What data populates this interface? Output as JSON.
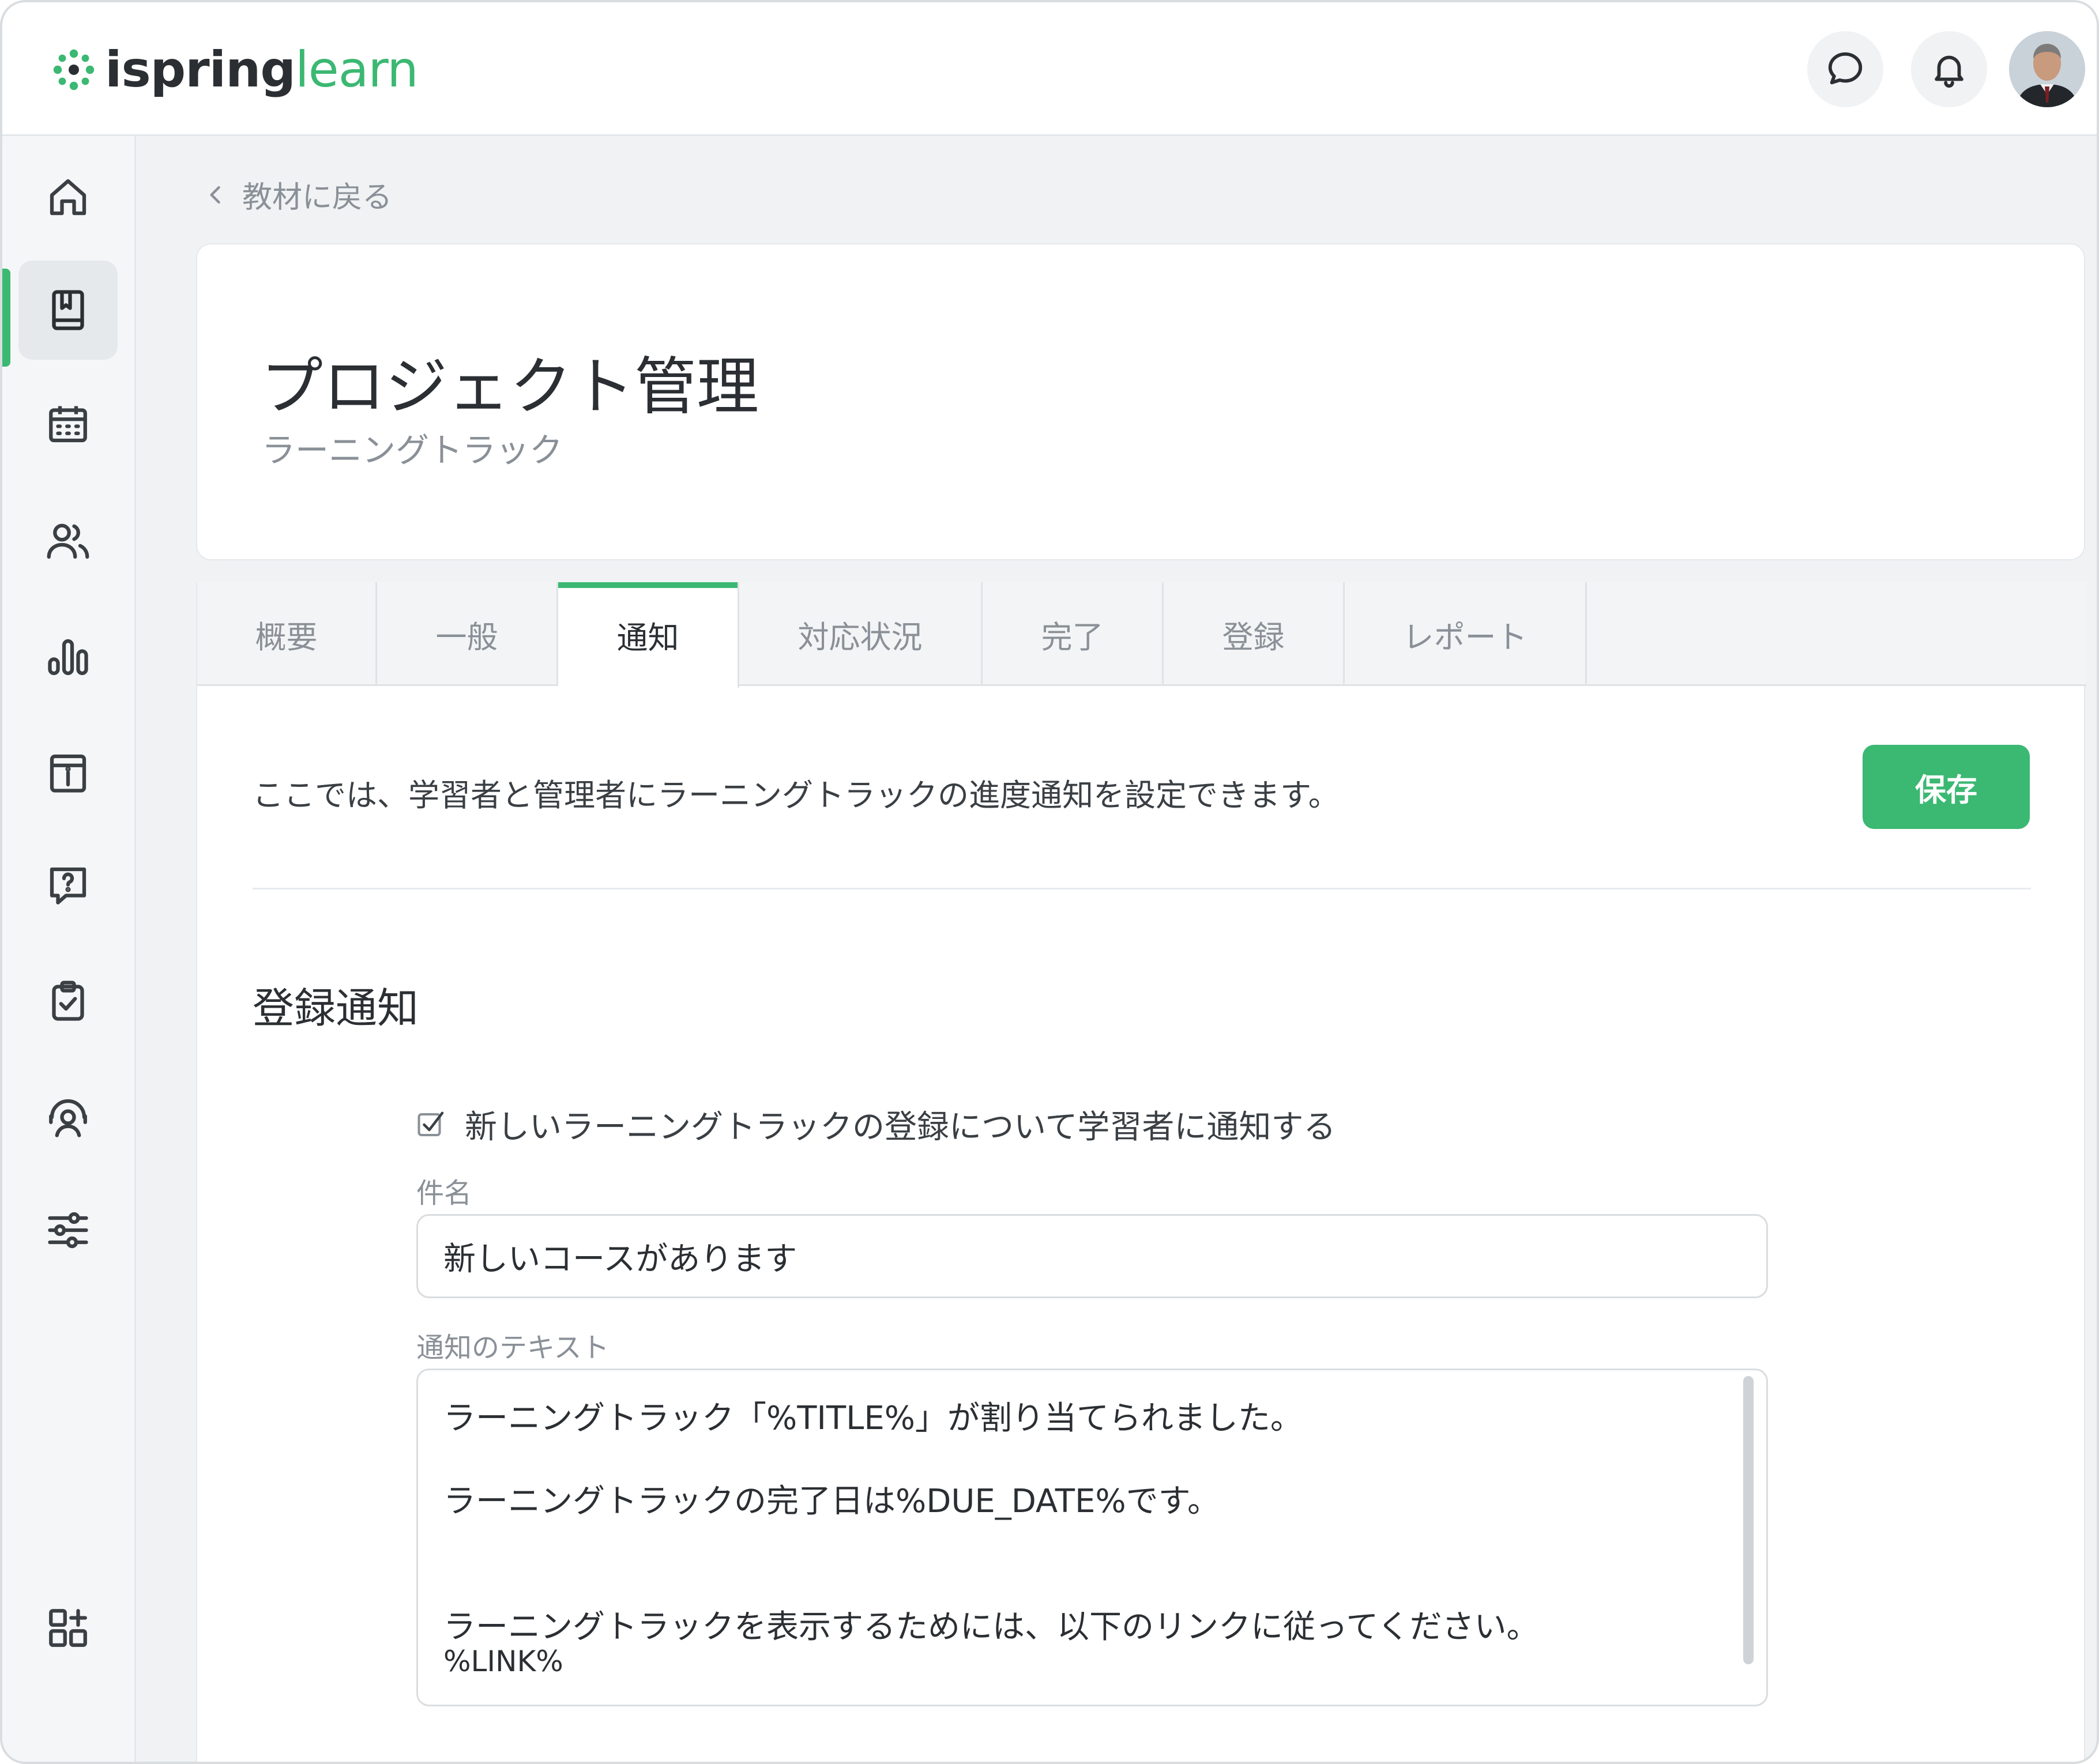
{
  "app": {
    "logo_part1": "ispring",
    "logo_part2": "learn",
    "brand_color": "#3bb872"
  },
  "header": {
    "icons": [
      "chat-icon",
      "bell-icon",
      "avatar"
    ]
  },
  "sidebar": {
    "items": [
      {
        "icon": "home-icon",
        "active": false
      },
      {
        "icon": "book-icon",
        "active": true
      },
      {
        "icon": "calendar-icon",
        "active": false
      },
      {
        "icon": "users-icon",
        "active": false
      },
      {
        "icon": "bar-chart-icon",
        "active": false
      },
      {
        "icon": "info-calendar-icon",
        "active": false
      },
      {
        "icon": "question-icon",
        "active": false
      },
      {
        "icon": "clipboard-check-icon",
        "active": false
      },
      {
        "icon": "support-agent-icon",
        "active": false
      },
      {
        "icon": "sliders-icon",
        "active": false
      },
      {
        "icon": "add-apps-icon",
        "active": false
      }
    ]
  },
  "breadcrumb": {
    "back_label": "教材に戻る"
  },
  "card": {
    "title": "プロジェクト管理",
    "subtitle": "ラーニングトラック"
  },
  "tabs": [
    {
      "label": "概要",
      "active": false
    },
    {
      "label": "一般",
      "active": false
    },
    {
      "label": "通知",
      "active": true
    },
    {
      "label": "対応状況",
      "active": false
    },
    {
      "label": "完了",
      "active": false
    },
    {
      "label": "登録",
      "active": false
    },
    {
      "label": "レポート",
      "active": false
    }
  ],
  "notifications": {
    "description": "ここでは、学習者と管理者にラーニングトラックの進度通知を設定できます。",
    "save_label": "保存",
    "section_title": "登録通知",
    "checkbox_label": "新しいラーニングトラックの登録について学習者に通知する",
    "checkbox_checked": true,
    "subject_label": "件名",
    "subject_value": "新しいコースがあります",
    "body_label": "通知のテキスト",
    "body_lines": [
      "ラーニングトラック「%TITLE%」が割り当てられました。",
      "ラーニングトラックの完了日は%DUE_DATE%です。",
      "ラーニングトラックを表示するためには、以下のリンクに従ってください。",
      "%LINK%"
    ]
  }
}
